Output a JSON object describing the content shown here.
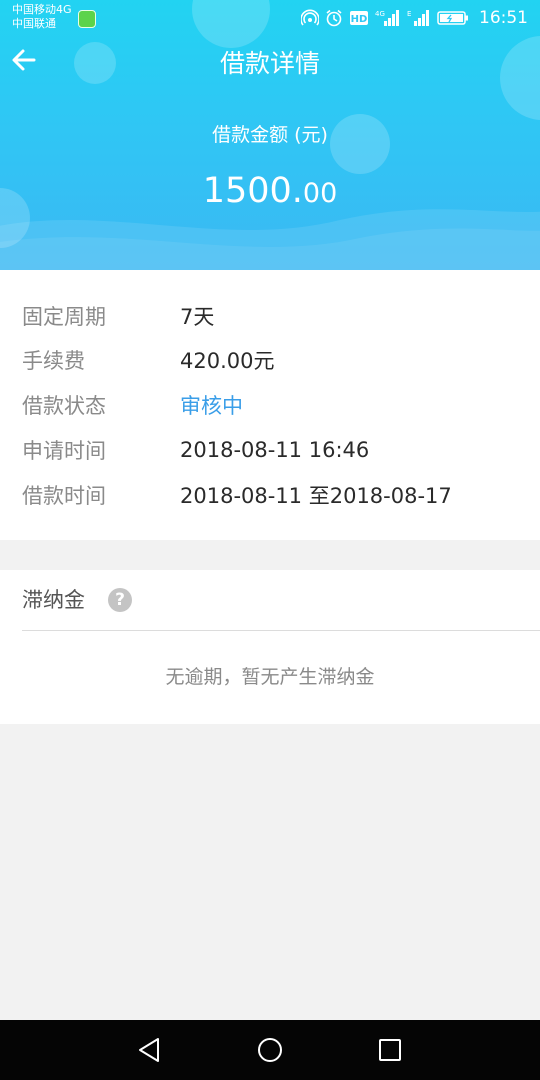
{
  "status_bar": {
    "carrier_line1": "中国移动4G",
    "carrier_line2": "中国联通",
    "time": "16:51",
    "icons": [
      "wechat-notification-icon",
      "hotspot-icon",
      "alarm-icon",
      "hd-icon",
      "signal-4g-icon",
      "signal-e-icon",
      "battery-icon"
    ]
  },
  "header": {
    "title": "借款详情",
    "amount_label": "借款金额 (元)",
    "amount_integer": "1500.",
    "amount_decimal": "00",
    "back_icon": "arrow-left-icon"
  },
  "details": [
    {
      "label": "固定周期",
      "value": "7天"
    },
    {
      "label": "手续费",
      "value": "420.00元"
    },
    {
      "label": "借款状态",
      "value": "审核中"
    },
    {
      "label": "申请时间",
      "value": "2018-08-11 16:46"
    },
    {
      "label": "借款时间",
      "value": "2018-08-11 至2018-08-17"
    }
  ],
  "late_fee": {
    "title": "滞纳金",
    "help_icon": "question-circle-icon",
    "help_glyph": "?",
    "empty_text": "无逾期，暂无产生滞纳金"
  },
  "nav_bar": {
    "icons": [
      "back-triangle-icon",
      "home-circle-icon",
      "recents-square-icon"
    ]
  },
  "colors": {
    "header_gradient_top": "#22d3f2",
    "header_gradient_bottom": "#3bb8f3",
    "status_highlight": "#3a9ee8",
    "label_gray": "#8a8a8a"
  }
}
